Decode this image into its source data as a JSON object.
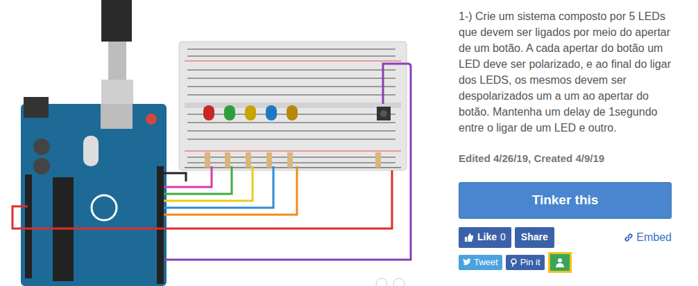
{
  "description": "1-) Crie um sistema composto por 5 LEDs que devem ser ligados por meio do apertar de um botão. A cada apertar do botão um LED deve ser polarizado, e ao final do ligar dos LEDS, os mesmos devem ser despolarizados um a um ao apertar do botão. Mantenha um delay de 1segundo entre o ligar de um LED e outro.",
  "meta": "Edited 4/26/19, Created 4/9/19",
  "tinker_button": "Tinker this",
  "like": {
    "label": "Like",
    "count": "0"
  },
  "share": "Share",
  "embed": "Embed",
  "tweet": "Tweet",
  "pin": "Pin it",
  "classroom": {
    "highlighted": true
  }
}
